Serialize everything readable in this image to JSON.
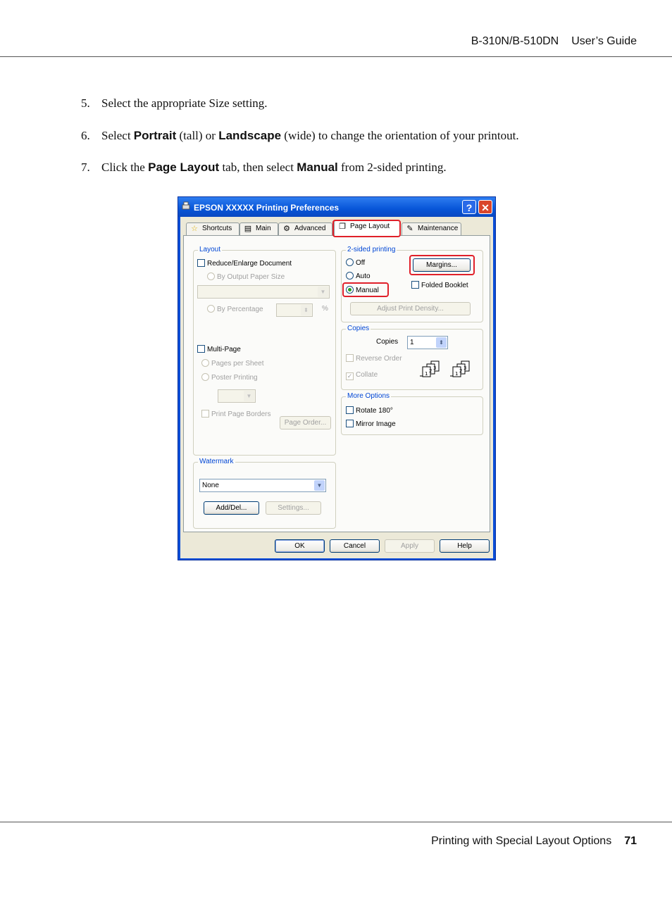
{
  "header": {
    "model": "B-310N/B-510DN",
    "guide": "User’s Guide"
  },
  "steps": [
    {
      "num": "5.",
      "parts": [
        "Select the appropriate Size setting."
      ]
    },
    {
      "num": "6.",
      "pre": "Select ",
      "b1": "Portrait",
      "mid1": " (tall) or ",
      "b2": "Landscape",
      "post": " (wide) to change the orientation of your printout."
    },
    {
      "num": "7.",
      "pre": "Click the ",
      "b1": "Page Layout",
      "mid1": " tab, then select ",
      "b2": "Manual",
      "post": " from 2-sided printing."
    }
  ],
  "dialog": {
    "title": "EPSON XXXXX  Printing Preferences",
    "help_btn": "?",
    "close_btn": "✕",
    "tabs": [
      "Shortcuts",
      "Main",
      "Advanced",
      "Page Layout",
      "Maintenance"
    ],
    "layout": {
      "label": "Layout",
      "reduce_enlarge": "Reduce/Enlarge Document",
      "by_output": "By Output Paper Size",
      "by_percentage": "By Percentage",
      "percent_sign": "%",
      "multi_page": "Multi-Page",
      "pages_per_sheet": "Pages per Sheet",
      "poster_printing": "Poster Printing",
      "print_page_borders": "Print Page Borders",
      "page_order": "Page Order..."
    },
    "two_sided": {
      "label": "2-sided printing",
      "off": "Off",
      "auto": "Auto",
      "manual": "Manual",
      "margins": "Margins...",
      "folded_booklet": "Folded Booklet",
      "adjust_density": "Adjust Print Density..."
    },
    "copies": {
      "label": "Copies",
      "copies_label": "Copies",
      "value": "1",
      "reverse_order": "Reverse Order",
      "collate": "Collate"
    },
    "more_options": {
      "label": "More Options",
      "rotate": "Rotate 180°",
      "mirror": "Mirror Image"
    },
    "watermark": {
      "label": "Watermark",
      "value": "None",
      "add_del": "Add/Del...",
      "settings": "Settings..."
    },
    "footer_buttons": {
      "ok": "OK",
      "cancel": "Cancel",
      "apply": "Apply",
      "help": "Help"
    }
  },
  "footer": {
    "section": "Printing with Special Layout Options",
    "page": "71"
  }
}
